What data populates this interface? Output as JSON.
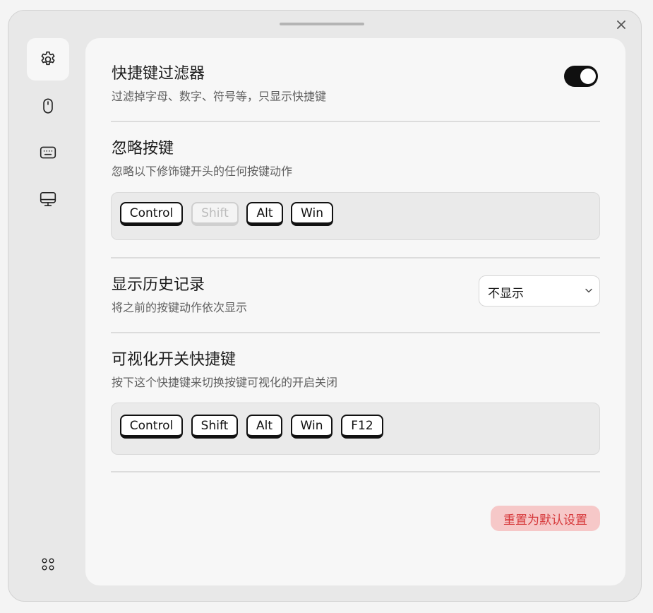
{
  "colors": {
    "accent": "#101010",
    "danger_text": "#d6383a",
    "danger_bg": "#f6c8c8",
    "panel_bg": "#f7f7f7",
    "window_bg": "#e8e8e8"
  },
  "window": {
    "close_icon": "close-icon"
  },
  "sidebar": {
    "items": [
      {
        "icon": "gear-icon",
        "active": true
      },
      {
        "icon": "mouse-icon",
        "active": false
      },
      {
        "icon": "keyboard-icon",
        "active": false
      },
      {
        "icon": "monitor-icon",
        "active": false
      }
    ],
    "bottom_icon": "apps-icon"
  },
  "settings": {
    "shortcut_filter": {
      "title": "快捷键过滤器",
      "description": "过滤掉字母、数字、符号等，只显示快捷键",
      "enabled": true
    },
    "ignore_keys": {
      "title": "忽略按键",
      "description": "忽略以下修饰键开头的任何按键动作",
      "keys": [
        {
          "label": "Control",
          "enabled": true
        },
        {
          "label": "Shift",
          "enabled": false
        },
        {
          "label": "Alt",
          "enabled": true
        },
        {
          "label": "Win",
          "enabled": true
        }
      ]
    },
    "history": {
      "title": "显示历史记录",
      "description": "将之前的按键动作依次显示",
      "selected": "不显示"
    },
    "toggle_shortcut": {
      "title": "可视化开关快捷键",
      "description": "按下这个快捷键来切换按键可视化的开启关闭",
      "keys": [
        "Control",
        "Shift",
        "Alt",
        "Win",
        "F12"
      ]
    },
    "reset_label": "重置为默认设置"
  }
}
